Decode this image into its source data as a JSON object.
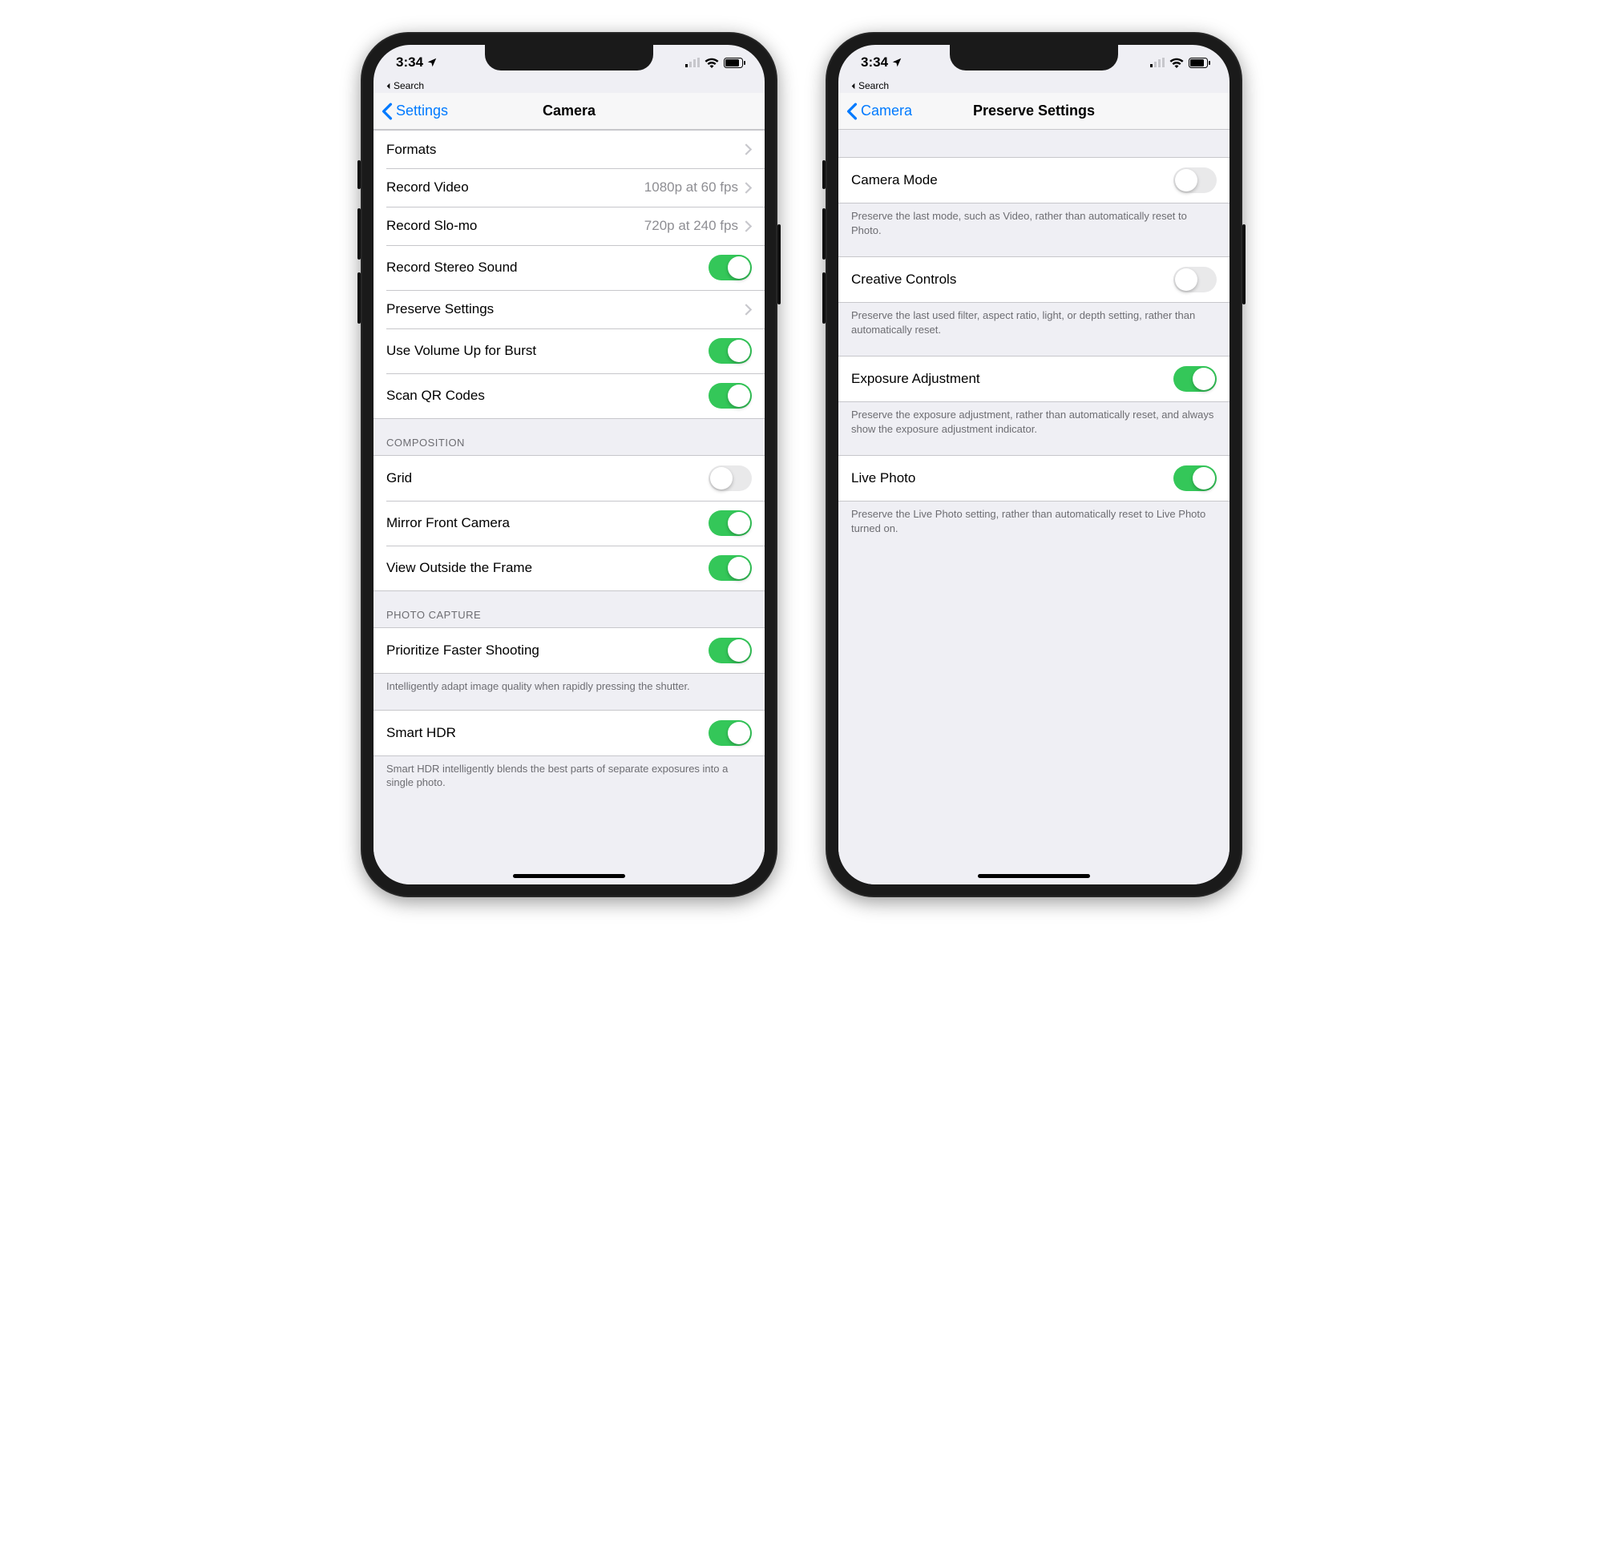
{
  "status": {
    "time": "3:34",
    "back_app": "Search"
  },
  "left_screen": {
    "back_label": "Settings",
    "title": "Camera",
    "rows": {
      "formats": "Formats",
      "record_video": "Record Video",
      "record_video_detail": "1080p at 60 fps",
      "record_slomo": "Record Slo-mo",
      "record_slomo_detail": "720p at 240 fps",
      "stereo": "Record Stereo Sound",
      "preserve": "Preserve Settings",
      "volume_burst": "Use Volume Up for Burst",
      "scan_qr": "Scan QR Codes"
    },
    "headers": {
      "composition": "COMPOSITION",
      "photo_capture": "PHOTO CAPTURE"
    },
    "composition": {
      "grid": "Grid",
      "mirror": "Mirror Front Camera",
      "view_outside": "View Outside the Frame"
    },
    "photo_capture": {
      "prioritize": "Prioritize Faster Shooting",
      "prioritize_footer": "Intelligently adapt image quality when rapidly pressing the shutter.",
      "smart_hdr": "Smart HDR",
      "smart_hdr_footer": "Smart HDR intelligently blends the best parts of separate exposures into a single photo."
    }
  },
  "right_screen": {
    "back_label": "Camera",
    "title": "Preserve Settings",
    "items": {
      "camera_mode": "Camera Mode",
      "camera_mode_footer": "Preserve the last mode, such as Video, rather than automatically reset to Photo.",
      "creative": "Creative Controls",
      "creative_footer": "Preserve the last used filter, aspect ratio, light, or depth setting, rather than automatically reset.",
      "exposure": "Exposure Adjustment",
      "exposure_footer": "Preserve the exposure adjustment, rather than automatically reset, and always show the exposure adjustment indicator.",
      "live_photo": "Live Photo",
      "live_photo_footer": "Preserve the Live Photo setting, rather than automatically reset to Live Photo turned on."
    }
  }
}
